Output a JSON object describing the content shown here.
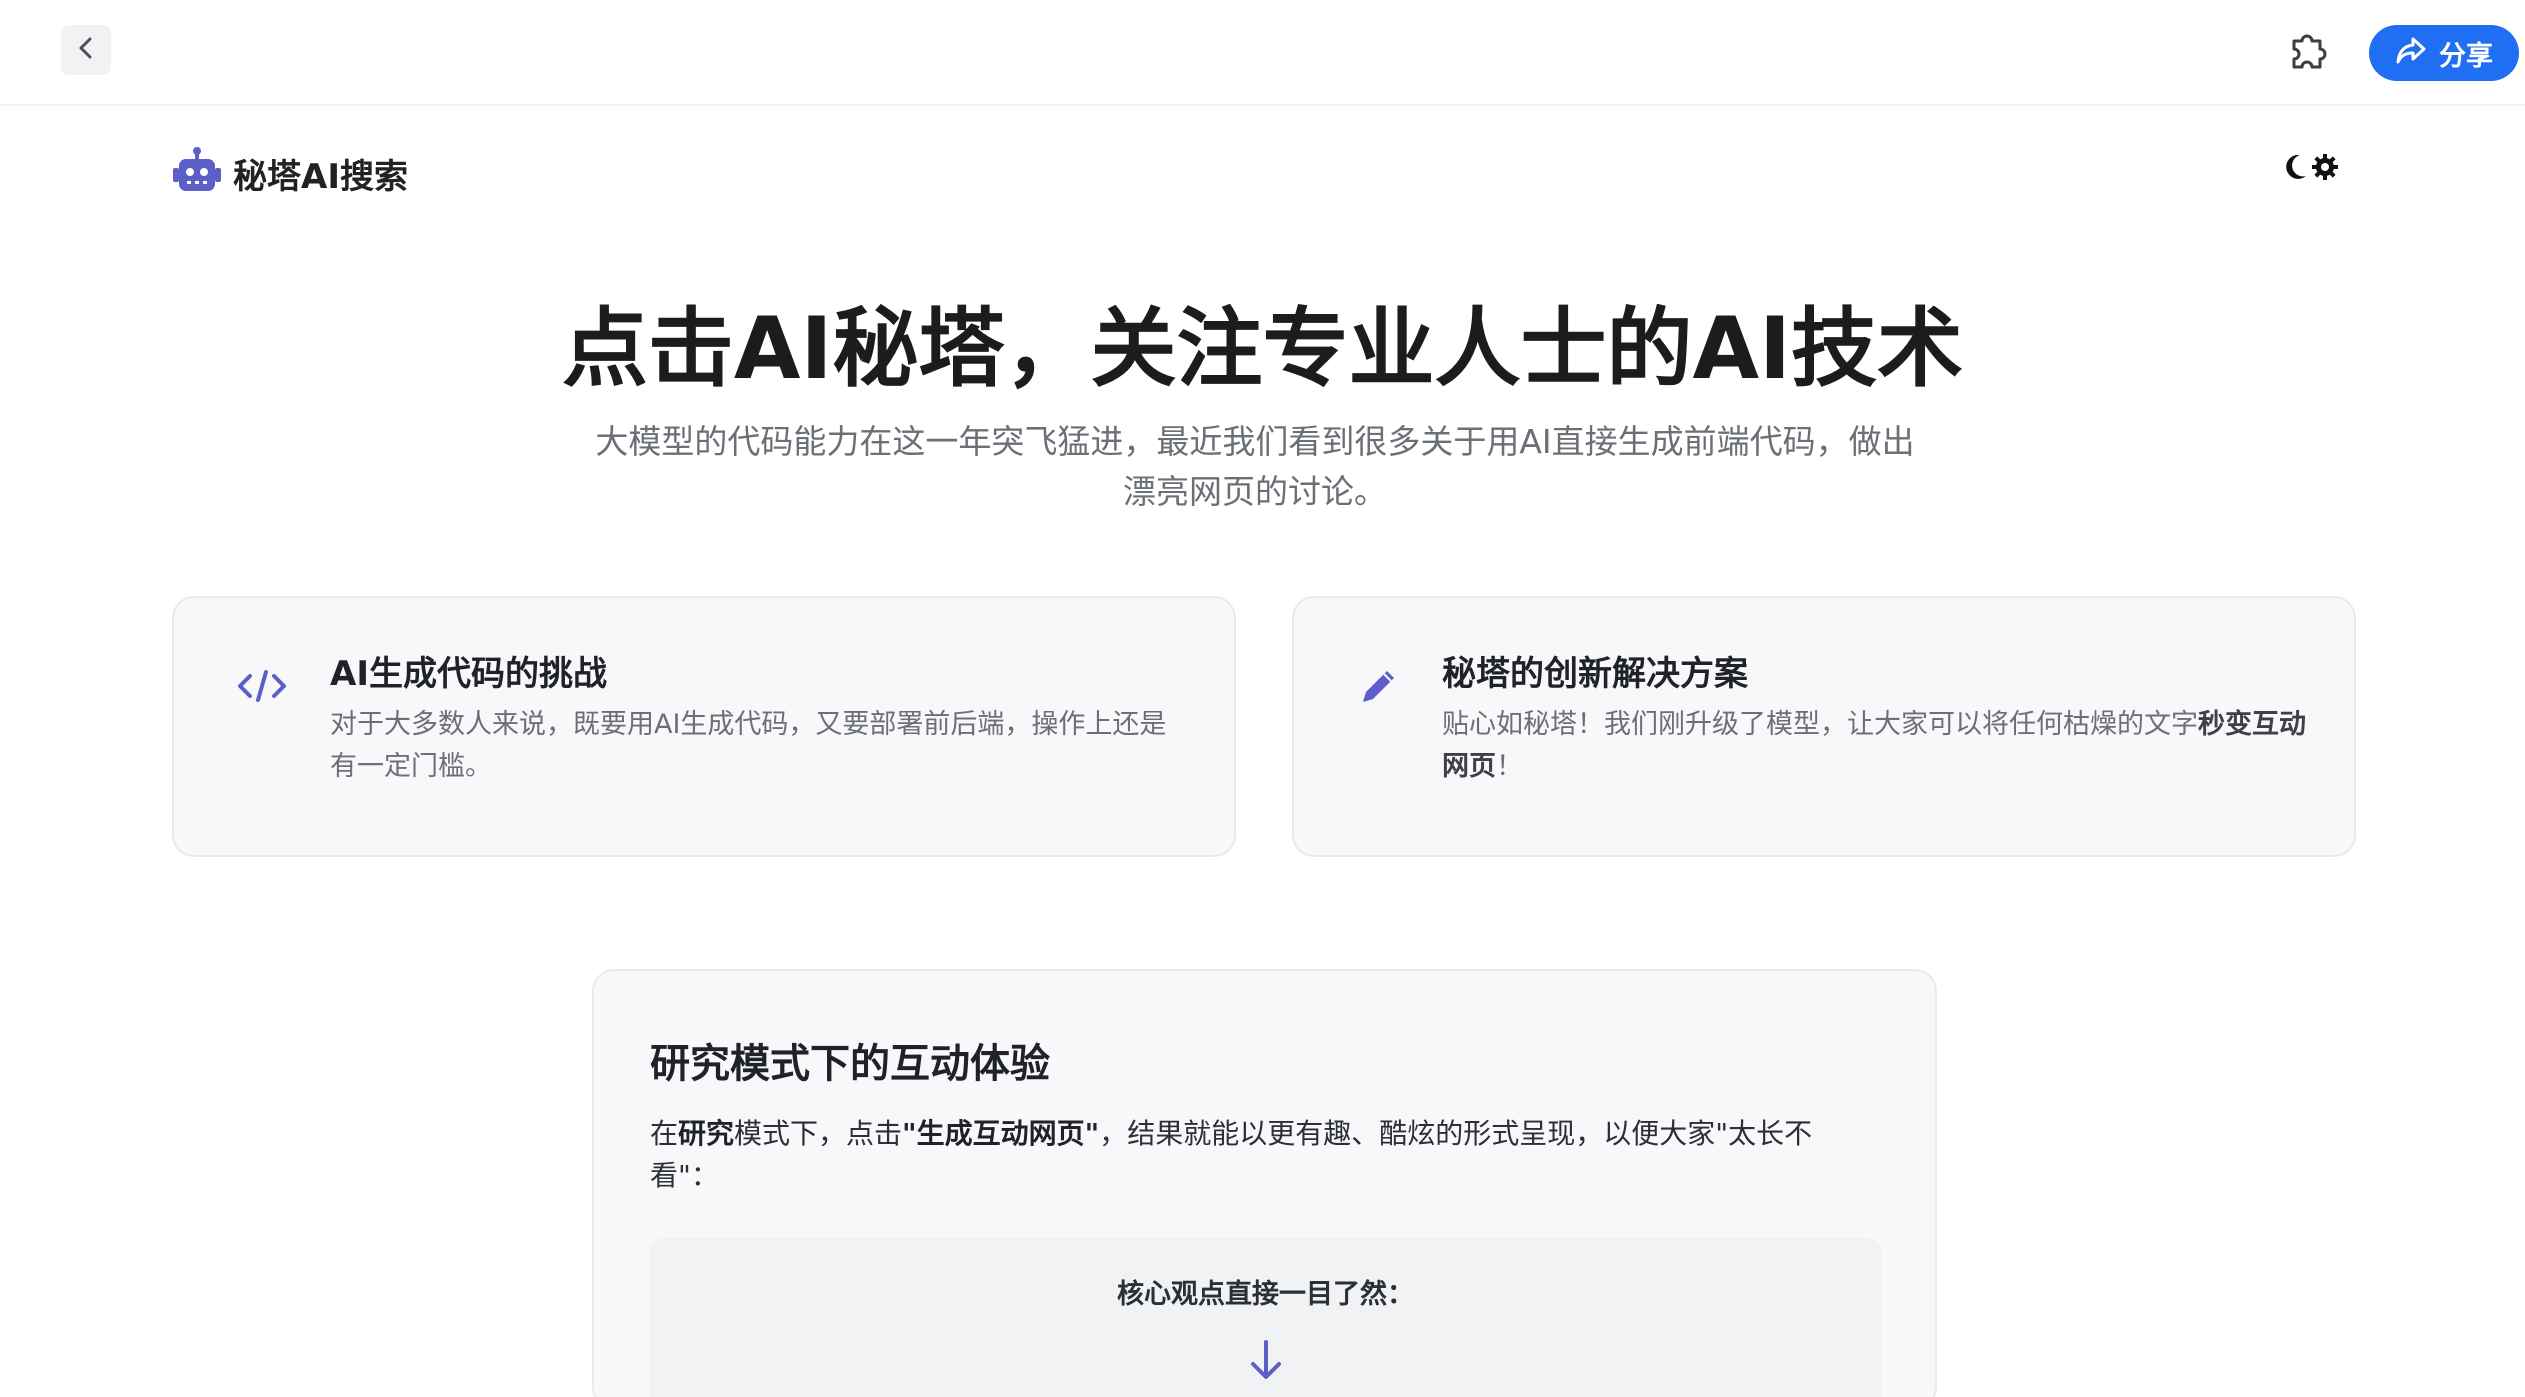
{
  "topbar": {
    "back_icon": "chevron-left-icon",
    "plugin_icon": "puzzle-icon",
    "share_label": "分享",
    "share_icon": "share-forward-icon"
  },
  "header": {
    "brand_name": "秘塔AI搜索",
    "brand_icon": "robot-icon",
    "theme_icons": [
      "moon-icon",
      "gear-icon"
    ]
  },
  "hero": {
    "title": "点击AI秘塔，关注专业人士的AI技术",
    "subtitle": "大模型的代码能力在这一年突飞猛进，最近我们看到很多关于用AI直接生成前端代码，做出漂亮网页的讨论。"
  },
  "cards": [
    {
      "icon": "code-icon",
      "title": "AI生成代码的挑战",
      "text": "对于大多数人来说，既要用AI生成代码，又要部署前后端，操作上还是有一定门槛。"
    },
    {
      "icon": "pencil-icon",
      "title": "秘塔的创新解决方案",
      "text_before": "贴心如秘塔！我们刚升级了模型，让大家可以将任何枯燥的文字",
      "text_bold": "秒变互动网页",
      "text_after": "！"
    }
  ],
  "research": {
    "title": "研究模式下的互动体验",
    "desc_1": "在",
    "desc_bold_1": "研究",
    "desc_2": "模式下，点击",
    "desc_bold_2": "\"生成互动网页\"",
    "desc_3": "，结果就能以更有趣、酷炫的形式呈现，以便大家\"太长不看\"：",
    "inner_label": "核心观点直接一目了然：",
    "arrow_icon": "arrow-down-icon"
  },
  "colors": {
    "accent": "#1f6ef3",
    "icon_purple": "#5b5fc7",
    "card_bg": "#f8f8fa"
  }
}
